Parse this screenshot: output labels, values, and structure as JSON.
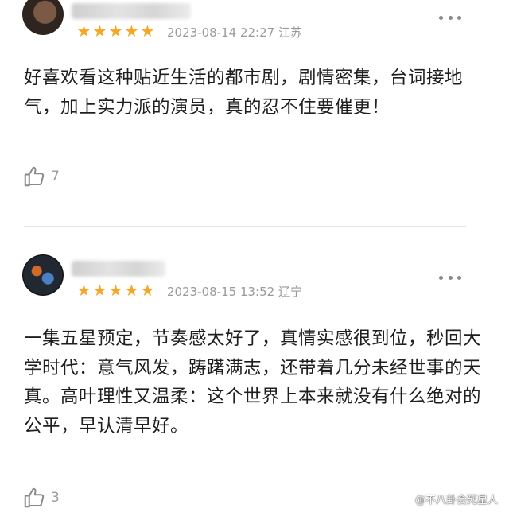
{
  "reviews": [
    {
      "rating": 5,
      "date": "2023-08-14 22:27",
      "location": "江苏",
      "content": "好喜欢看这种贴近生活的都市剧，剧情密集，台词接地气，加上实力派的演员，真的忍不住要催更！",
      "likes": "7"
    },
    {
      "rating": 5,
      "date": "2023-08-15 13:52",
      "location": "辽宁",
      "content": "一集五星预定，节奏感太好了，真情实感很到位，秒回大学时代：意气风发，踌躇满志，还带着几分未经世事的天真。高叶理性又温柔：这个世界上本来就没有什么绝对的公平，早认清早好。",
      "likes": "3"
    }
  ],
  "watermark": "@不八卦会死星人",
  "colors": {
    "star": "#f6a623",
    "meta": "#9a9a9a",
    "text": "#1f1f1f"
  },
  "icons": {
    "like": "thumbs-up-icon",
    "more": "more-dots-icon",
    "rating": "star-icon"
  }
}
